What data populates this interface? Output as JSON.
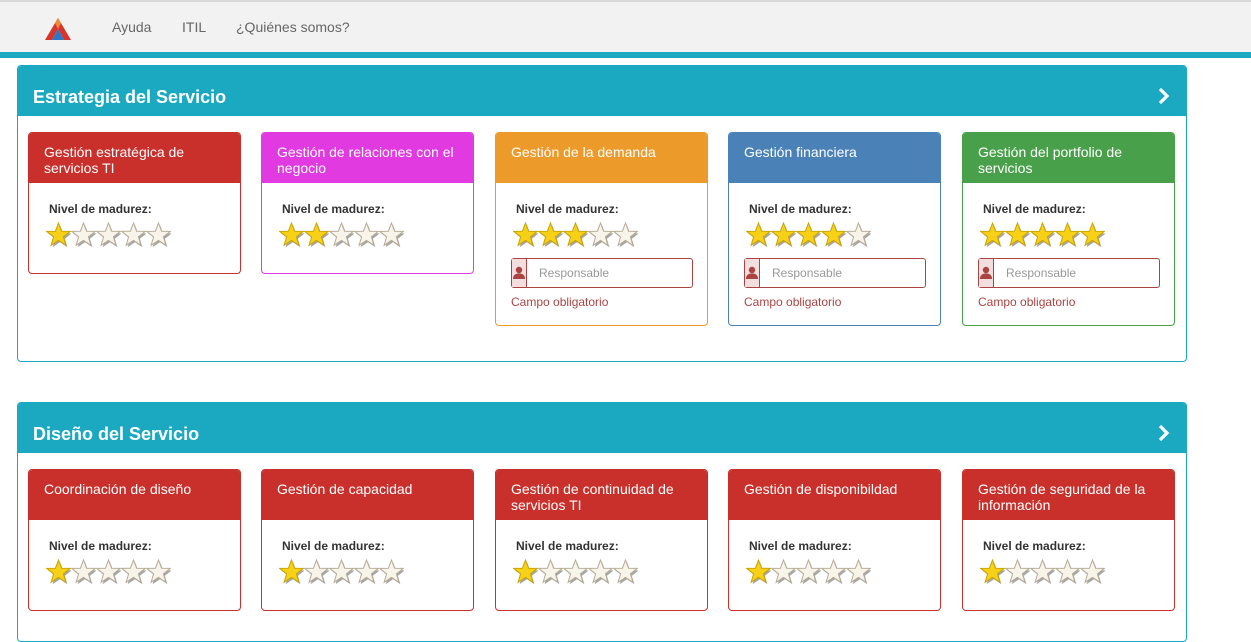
{
  "nav": {
    "links": [
      "Ayuda",
      "ITIL",
      "¿Quiénes somos?"
    ]
  },
  "colors": {
    "accent": "#1ba9c1",
    "red": "#c9302c",
    "magenta": "#e03ae0",
    "orange": "#ec9a2a",
    "blue": "#4a82b8",
    "green": "#48a14a",
    "error": "#a94442"
  },
  "sections": [
    {
      "title": "Estrategia del Servicio",
      "cards": [
        {
          "title": "Gestión estratégica de servicios TI",
          "color": "#c9302c",
          "maturity_label": "Nivel de madurez:",
          "stars": 1,
          "show_responsable": false
        },
        {
          "title": "Gestión de relaciones con el negocio",
          "color": "#e03ae0",
          "maturity_label": "Nivel de madurez:",
          "stars": 2,
          "show_responsable": false
        },
        {
          "title": "Gestión de la demanda",
          "color": "#ec9a2a",
          "maturity_label": "Nivel de madurez:",
          "stars": 3,
          "show_responsable": true,
          "placeholder": "Responsable",
          "error": "Campo obligatorio"
        },
        {
          "title": "Gestión financiera",
          "color": "#4a82b8",
          "maturity_label": "Nivel de madurez:",
          "stars": 4,
          "show_responsable": true,
          "placeholder": "Responsable",
          "error": "Campo obligatorio"
        },
        {
          "title": "Gestión del portfolio de servicios",
          "color": "#48a14a",
          "maturity_label": "Nivel de madurez:",
          "stars": 5,
          "show_responsable": true,
          "placeholder": "Responsable",
          "error": "Campo obligatorio"
        }
      ]
    },
    {
      "title": "Diseño del Servicio",
      "cards": [
        {
          "title": "Coordinación de diseño",
          "color": "#c9302c",
          "maturity_label": "Nivel de madurez:",
          "stars": 1,
          "show_responsable": false
        },
        {
          "title": "Gestión de capacidad",
          "color": "#c9302c",
          "maturity_label": "Nivel de madurez:",
          "stars": 1,
          "show_responsable": false
        },
        {
          "title": "Gestión de continuidad de servicios TI",
          "color": "#c9302c",
          "maturity_label": "Nivel de madurez:",
          "stars": 1,
          "show_responsable": false
        },
        {
          "title": "Gestión de disponibildad",
          "color": "#c9302c",
          "maturity_label": "Nivel de madurez:",
          "stars": 1,
          "show_responsable": false
        },
        {
          "title": "Gestión de seguridad de la información",
          "color": "#c9302c",
          "maturity_label": "Nivel de madurez:",
          "stars": 1,
          "show_responsable": false
        }
      ]
    }
  ]
}
